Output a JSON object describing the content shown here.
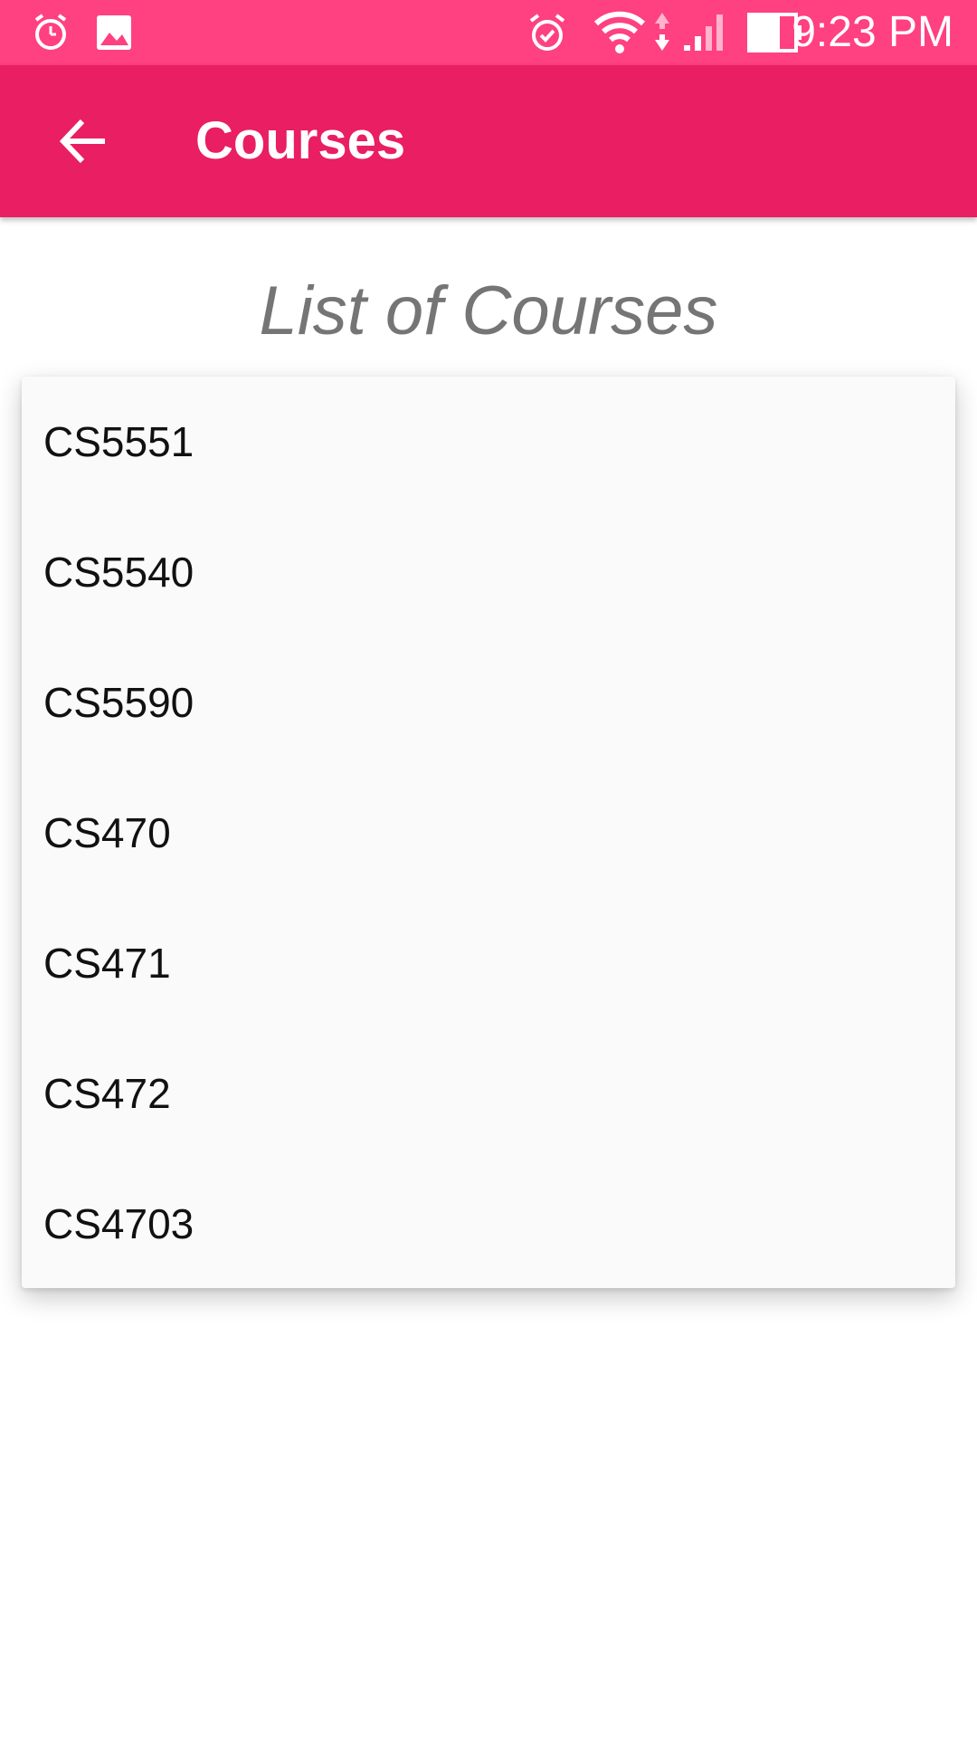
{
  "status_bar": {
    "time": "9:23 PM",
    "icons": [
      "alarm-clock-icon",
      "image-icon",
      "alarm-icon",
      "wifi-icon",
      "data-transfer-icon",
      "cell-signal-icon",
      "battery-icon"
    ],
    "color": "#ff4081"
  },
  "app_bar": {
    "title": "Courses",
    "back_icon": "arrow-back-icon",
    "color": "#e91e63"
  },
  "main": {
    "heading": "List of Courses",
    "courses": [
      {
        "label": "CS5551"
      },
      {
        "label": "CS5540"
      },
      {
        "label": "CS5590"
      },
      {
        "label": "CS470"
      },
      {
        "label": "CS471"
      },
      {
        "label": "CS472"
      },
      {
        "label": "CS4703"
      }
    ]
  }
}
